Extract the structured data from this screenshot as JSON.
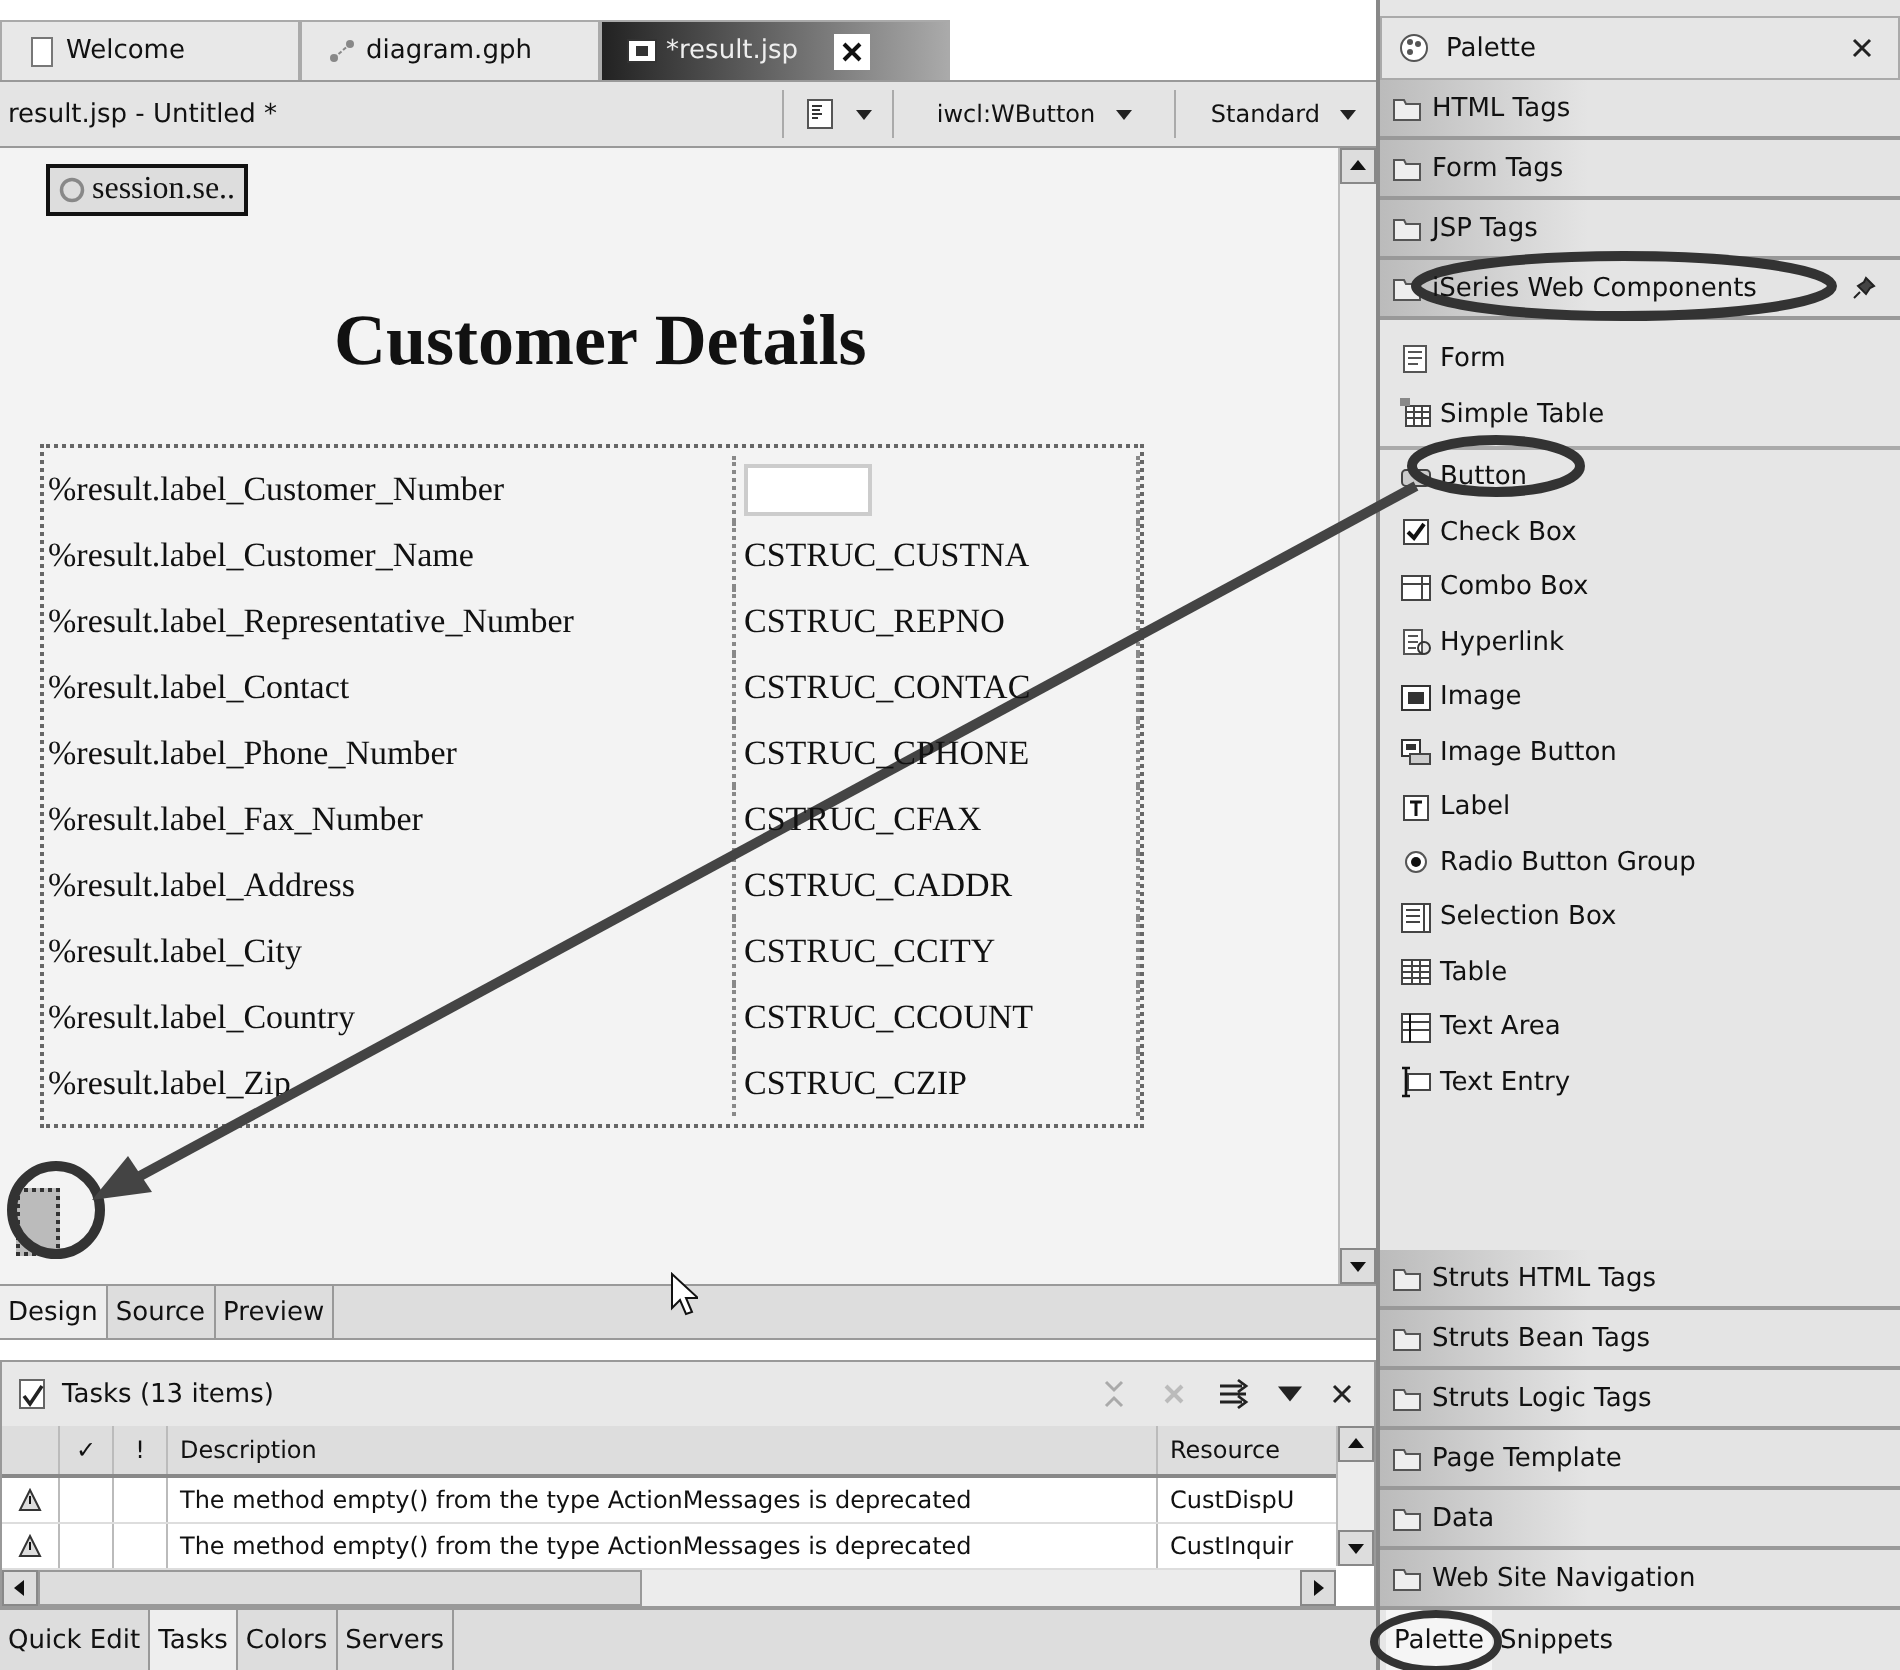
{
  "editor_tabs": [
    {
      "label": "Welcome",
      "selected": false,
      "kind": "page"
    },
    {
      "label": "diagram.gph",
      "selected": false,
      "kind": "diagram"
    },
    {
      "label": "*result.jsp",
      "selected": true,
      "kind": "jsp"
    }
  ],
  "editor_toolbar": {
    "title": "result.jsp - Untitled *",
    "component_combo": "iwcl:WButton",
    "style_combo": "Standard"
  },
  "canvas": {
    "session_bean": "session.se..",
    "heading": "Customer Details",
    "rows": [
      {
        "label": "%result.label_Customer_Number",
        "kind": "input"
      },
      {
        "label": "%result.label_Customer_Name",
        "kind": "text",
        "value": "CSTRUC_CUSTNA"
      },
      {
        "label": "%result.label_Representative_Number",
        "kind": "text",
        "value": "CSTRUC_REPNO"
      },
      {
        "label": "%result.label_Contact",
        "kind": "text",
        "value": "CSTRUC_CONTAC"
      },
      {
        "label": "%result.label_Phone_Number",
        "kind": "text",
        "value": "CSTRUC_CPHONE"
      },
      {
        "label": "%result.label_Fax_Number",
        "kind": "text",
        "value": "CSTRUC_CFAX"
      },
      {
        "label": "%result.label_Address",
        "kind": "text",
        "value": "CSTRUC_CADDR"
      },
      {
        "label": "%result.label_City",
        "kind": "text",
        "value": "CSTRUC_CCITY"
      },
      {
        "label": "%result.label_Country",
        "kind": "text",
        "value": "CSTRUC_CCOUNT"
      },
      {
        "label": "%result.label_Zip",
        "kind": "text",
        "value": "CSTRUC_CZIP"
      }
    ]
  },
  "view_tabs": [
    {
      "label": "Design",
      "selected": true
    },
    {
      "label": "Source",
      "selected": false
    },
    {
      "label": "Preview",
      "selected": false
    }
  ],
  "tasks": {
    "title": "Tasks (13 items)",
    "columns": [
      "✓",
      "!",
      "Description",
      "Resource"
    ],
    "rows": [
      {
        "description": "The method empty() from the type ActionMessages is deprecated",
        "resource": "CustDispU"
      },
      {
        "description": "The method empty() from the type ActionMessages is deprecated",
        "resource": "CustInquir"
      }
    ]
  },
  "bottom_tabs": [
    {
      "label": "Quick Edit",
      "selected": false
    },
    {
      "label": "Tasks",
      "selected": true
    },
    {
      "label": "Colors",
      "selected": false
    },
    {
      "label": "Servers",
      "selected": false
    }
  ],
  "palette": {
    "title": "Palette",
    "drawers": [
      {
        "label": "HTML Tags"
      },
      {
        "label": "Form Tags"
      },
      {
        "label": "JSP Tags"
      },
      {
        "label": "iSeries Web Components",
        "pinned": true,
        "item_groups": [
          [
            {
              "label": "Form",
              "kind": "form"
            },
            {
              "label": "Simple Table",
              "kind": "simple-table"
            }
          ],
          [
            {
              "label": "Button",
              "kind": "button"
            },
            {
              "label": "Check Box",
              "kind": "checkbox"
            },
            {
              "label": "Combo Box",
              "kind": "combo"
            },
            {
              "label": "Hyperlink",
              "kind": "hyperlink"
            },
            {
              "label": "Image",
              "kind": "image"
            },
            {
              "label": "Image Button",
              "kind": "image-button"
            },
            {
              "label": "Label",
              "kind": "label"
            },
            {
              "label": "Radio Button Group",
              "kind": "radio"
            },
            {
              "label": "Selection Box",
              "kind": "selection"
            },
            {
              "label": "Table",
              "kind": "table"
            },
            {
              "label": "Text Area",
              "kind": "textarea"
            },
            {
              "label": "Text Entry",
              "kind": "textentry"
            }
          ]
        ]
      },
      {
        "label": "Struts HTML Tags"
      },
      {
        "label": "Struts Bean Tags"
      },
      {
        "label": "Struts Logic Tags"
      },
      {
        "label": "Page Template"
      },
      {
        "label": "Data"
      },
      {
        "label": "Web Site Navigation"
      }
    ],
    "tabs": [
      {
        "label": "Palette",
        "selected": true
      },
      {
        "label": "Snippets",
        "selected": false
      }
    ]
  }
}
